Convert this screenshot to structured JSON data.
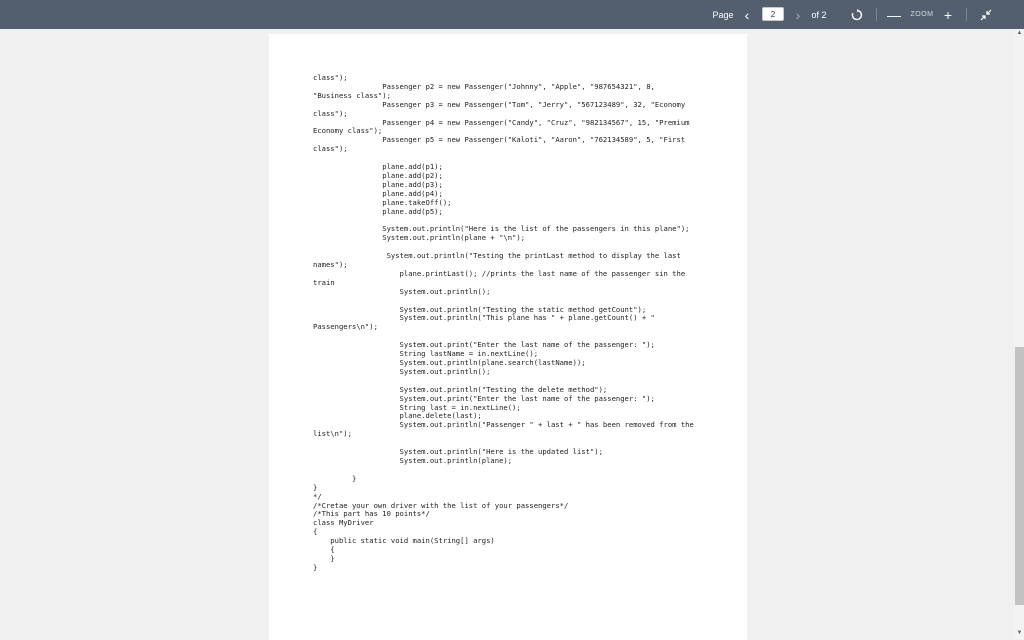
{
  "toolbar": {
    "page_label": "Page",
    "current_page": "2",
    "of_label": "of 2",
    "zoom_label": "ZOOM",
    "zoom_out_symbol": "—",
    "zoom_in_symbol": "+",
    "prev_symbol": "‹",
    "next_symbol": "›",
    "icons": [
      "chevron-left-icon",
      "chevron-right-icon",
      "refresh-icon",
      "minus-icon",
      "plus-icon",
      "collapse-icon"
    ],
    "bg_color": "#535f6e"
  },
  "document": {
    "code_lines": [
      "class\");",
      "                Passenger p2 = new Passenger(\"Johnny\", \"Apple\", \"987654321\", 8,",
      "\"Business class\");",
      "                Passenger p3 = new Passenger(\"Tom\", \"Jerry\", \"567123489\", 32, \"Economy",
      "class\");",
      "                Passenger p4 = new Passenger(\"Candy\", \"Cruz\", \"982134567\", 15, \"Premium",
      "Economy class\");",
      "                Passenger p5 = new Passenger(\"Kaloti\", \"Aaron\", \"762134589\", 5, \"First",
      "class\");",
      "",
      "                plane.add(p1);",
      "                plane.add(p2);",
      "                plane.add(p3);",
      "                plane.add(p4);",
      "                plane.takeOff();",
      "                plane.add(p5);",
      "",
      "                System.out.println(\"Here is the list of the passengers in this plane\");",
      "                System.out.println(plane + \"\\n\");",
      "",
      "                 System.out.println(\"Testing the printLast method to display the last",
      "names\");",
      "                    plane.printLast(); //prints the last name of the passenger sin the",
      "train",
      "                    System.out.println();",
      "",
      "                    System.out.println(\"Testing the static method getCount\");",
      "                    System.out.println(\"This plane has \" + plane.getCount() + \"",
      "Passengers\\n\");",
      "",
      "                    System.out.print(\"Enter the last name of the passenger: \");",
      "                    String lastName = in.nextLine();",
      "                    System.out.println(plane.search(lastName));",
      "                    System.out.println();",
      "",
      "                    System.out.println(\"Testing the delete method\");",
      "                    System.out.print(\"Enter the last name of the passenger: \");",
      "                    String last = in.nextLine();",
      "                    plane.delete(last);",
      "                    System.out.println(\"Passenger \" + last + \" has been removed from the",
      "list\\n\");",
      "",
      "                    System.out.println(\"Here is the updated list\");",
      "                    System.out.println(plane);",
      "",
      "         }",
      "}",
      "*/",
      "/*Cretae your own driver with the list of your passengers*/",
      "/*This part has 10 points*/",
      "class MyDriver",
      "{",
      "    public static void main(String[] args)",
      "    {",
      "    }",
      "}"
    ]
  }
}
